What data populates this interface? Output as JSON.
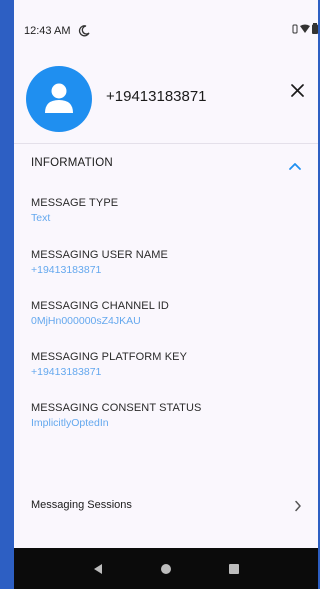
{
  "status_bar": {
    "time": "12:43 AM",
    "icons": [
      "moon-icon",
      "vibrate-icon",
      "wifi-icon",
      "battery-icon"
    ]
  },
  "header": {
    "contact_name": "+19413183871",
    "avatar_icon": "person-icon",
    "close_icon": "close-icon"
  },
  "information": {
    "title": "INFORMATION",
    "expanded": true,
    "fields": [
      {
        "label": "MESSAGE TYPE",
        "value": "Text"
      },
      {
        "label": "MESSAGING USER NAME",
        "value": "+19413183871"
      },
      {
        "label": "MESSAGING CHANNEL ID",
        "value": "0MjHn000000sZ4JKAU"
      },
      {
        "label": "MESSAGING PLATFORM KEY",
        "value": "+19413183871"
      },
      {
        "label": "MESSAGING CONSENT STATUS",
        "value": "ImplicitlyOptedIn"
      }
    ]
  },
  "sessions": {
    "label": "Messaging Sessions"
  },
  "nav_bar": {
    "buttons": [
      "back-icon",
      "home-icon",
      "recents-icon"
    ]
  },
  "colors": {
    "accent": "#1f8ff0",
    "value_text": "#64a8ee",
    "frame": "#2d5fc3",
    "nav_background": "#0b0b0b"
  }
}
